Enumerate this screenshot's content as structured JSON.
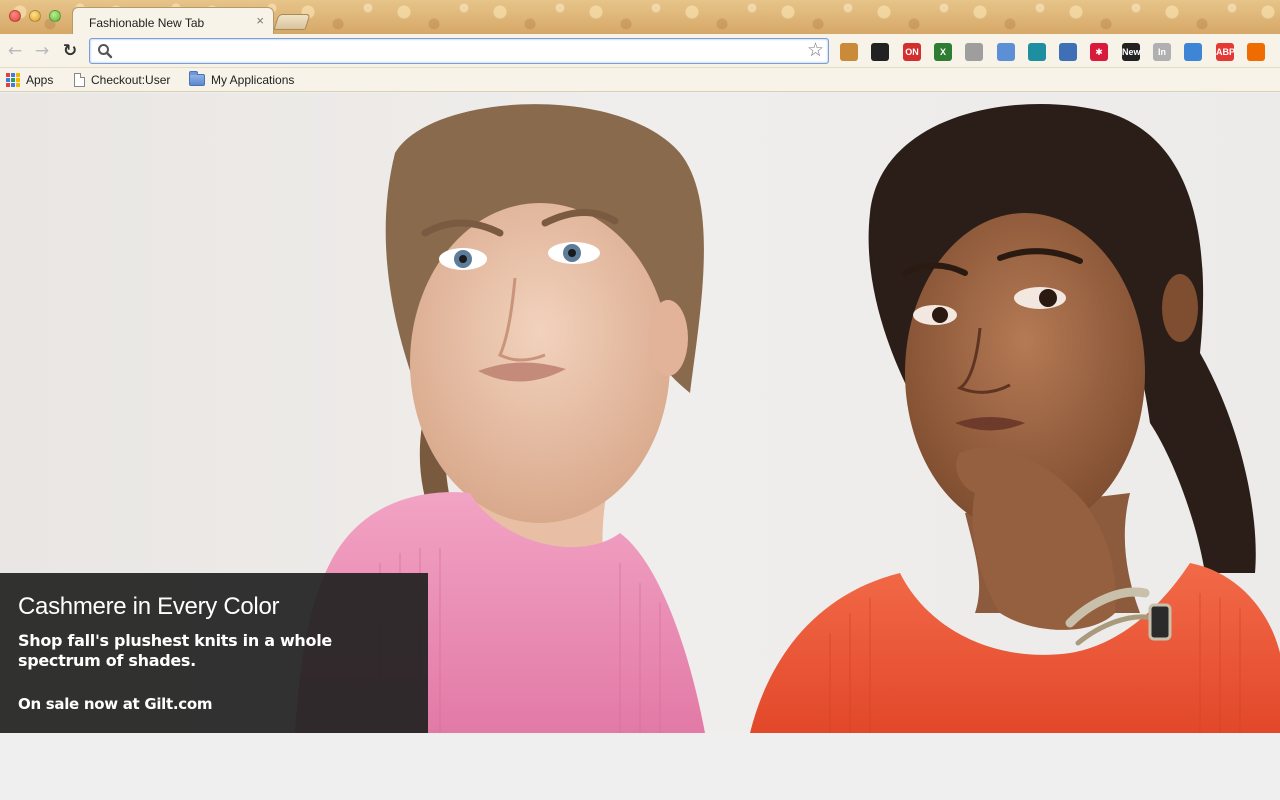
{
  "window": {
    "tab_title": "Fashionable New Tab",
    "tab_close": "×"
  },
  "toolbar": {
    "back_icon": "←",
    "forward_icon": "→",
    "reload_icon": "↻",
    "omnibox_value": "",
    "bookmark_star": "☆",
    "extensions": [
      {
        "name": "wooden-sign-icon",
        "color": "#c98a3a",
        "label": ""
      },
      {
        "name": "eyedropper-icon",
        "color": "#222222",
        "label": ""
      },
      {
        "name": "adblock-on-icon",
        "color": "#d32f2f",
        "label": "ON"
      },
      {
        "name": "excel-x-icon",
        "color": "#2e7d32",
        "label": "X"
      },
      {
        "name": "download-circle-icon",
        "color": "#9e9e9e",
        "label": ""
      },
      {
        "name": "folder-window-icon",
        "color": "#5c8fd6",
        "label": ""
      },
      {
        "name": "teal-wave-icon",
        "color": "#1e8fa0",
        "label": ""
      },
      {
        "name": "screen-capture-icon",
        "color": "#3f6fb5",
        "label": ""
      },
      {
        "name": "red-asterisk-icon",
        "color": "#d81b3b",
        "label": "✱"
      },
      {
        "name": "color-wheel-new-icon",
        "color": "#222222",
        "label": "New"
      },
      {
        "name": "linkedin-grey-icon",
        "color": "#b0b0b0",
        "label": "In"
      },
      {
        "name": "code-bracket-icon",
        "color": "#3f85d6",
        "label": ""
      },
      {
        "name": "adblock-plus-icon",
        "color": "#e53935",
        "label": "ABP"
      },
      {
        "name": "flame-icon",
        "color": "#ef6c00",
        "label": ""
      }
    ]
  },
  "bookmarks": {
    "apps": "Apps",
    "checkout": "Checkout:User",
    "my_applications": "My Applications"
  },
  "hero": {
    "title": "Cashmere in Every Color",
    "subtitle": "Shop fall's plushest knits in a whole spectrum of shades.",
    "link": "On sale now at Gilt.com"
  },
  "colors": {
    "tab_bg": "#f7f3e8",
    "theme_gold": "#d6a868",
    "caption_bg": "#222222",
    "pink_sweater": "#ea8db4",
    "orange_sweater": "#ee5a3a"
  }
}
